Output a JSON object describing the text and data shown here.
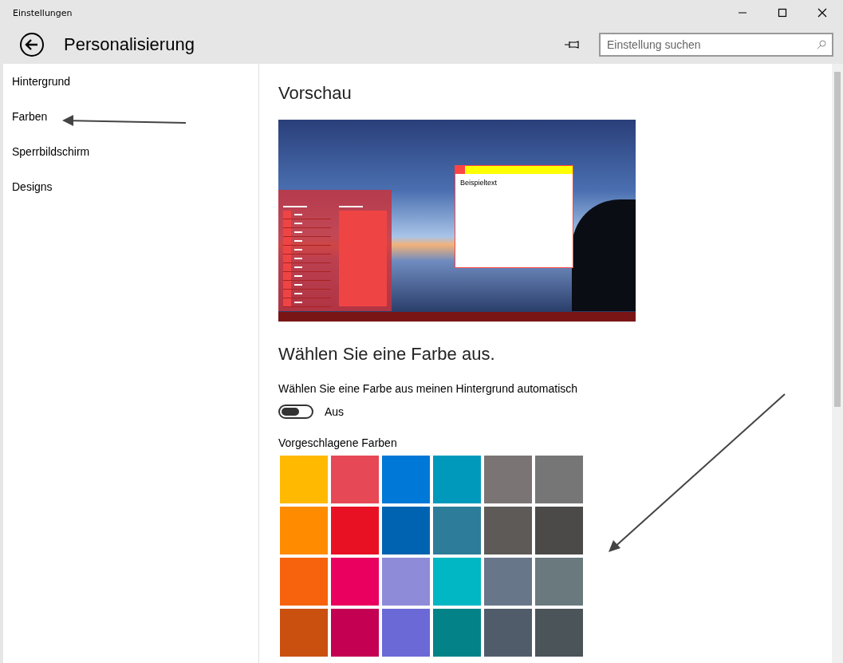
{
  "window": {
    "title": "Einstellungen"
  },
  "header": {
    "title": "Personalisierung",
    "search": {
      "placeholder": "Einstellung suchen"
    }
  },
  "sidebar": {
    "items": [
      {
        "label": "Hintergrund"
      },
      {
        "label": "Farben"
      },
      {
        "label": "Sperrbildschirm"
      },
      {
        "label": "Designs"
      }
    ]
  },
  "preview": {
    "heading": "Vorschau",
    "sample_text": "Beispieltext"
  },
  "color_section": {
    "heading": "Wählen Sie eine Farbe aus.",
    "auto_label": "Wählen Sie eine Farbe aus meinen Hintergrund automatisch",
    "toggle": {
      "on": false,
      "label": "Aus"
    },
    "suggested_heading": "Vorgeschlagene Farben",
    "swatches": [
      {
        "color": "#ffb900"
      },
      {
        "color": "#e74856"
      },
      {
        "color": "#0078d7"
      },
      {
        "color": "#0099bc"
      },
      {
        "color": "#7a7574"
      },
      {
        "color": "#767676"
      },
      {
        "color": "#ff8c00"
      },
      {
        "color": "#e81123"
      },
      {
        "color": "#0063b1"
      },
      {
        "color": "#2d7d9a"
      },
      {
        "color": "#5d5a58"
      },
      {
        "color": "#4c4a48"
      },
      {
        "color": "#f7630c"
      },
      {
        "color": "#ea005e"
      },
      {
        "color": "#8e8cd8"
      },
      {
        "color": "#00b7c3"
      },
      {
        "color": "#68768a"
      },
      {
        "color": "#69797e"
      },
      {
        "color": "#ca5010"
      },
      {
        "color": "#c30052"
      },
      {
        "color": "#6b69d6"
      },
      {
        "color": "#038387"
      },
      {
        "color": "#515c6b"
      },
      {
        "color": "#4a5459"
      }
    ]
  }
}
